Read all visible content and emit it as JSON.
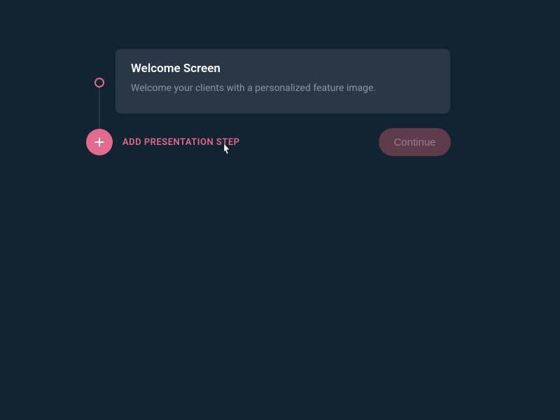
{
  "card": {
    "title": "Welcome Screen",
    "description": "Welcome your clients with a personalized feature image."
  },
  "actions": {
    "add_label": "ADD PRESENTATION STEP",
    "continue_label": "Continue"
  }
}
